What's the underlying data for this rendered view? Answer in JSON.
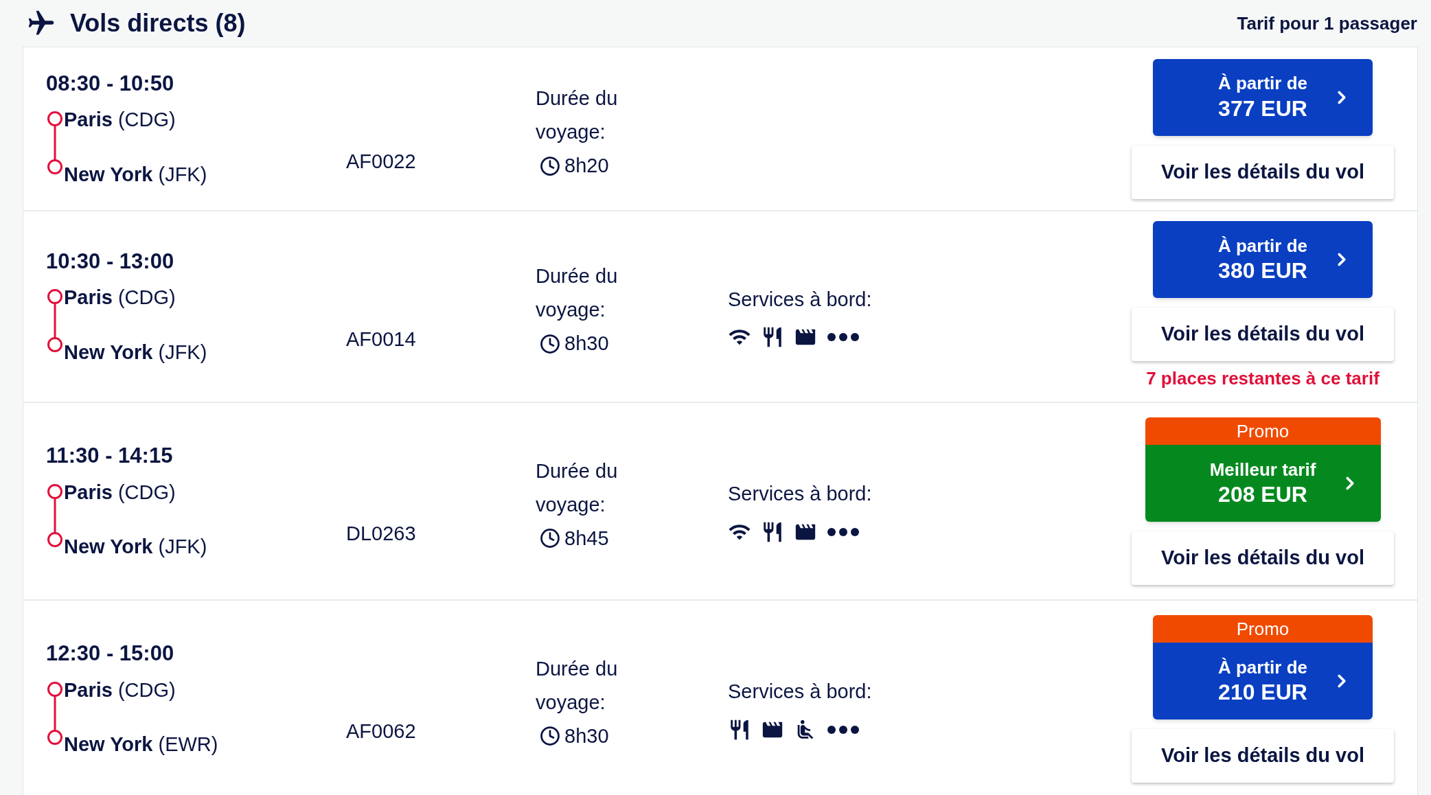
{
  "header": {
    "title": "Vols directs (8)",
    "fare_note": "Tarif pour 1 passager"
  },
  "flights": [
    {
      "times": "08:30 - 10:50",
      "origin": {
        "city": "Paris",
        "code": "(CDG)"
      },
      "destination": {
        "city": "New York",
        "code": "(JFK)"
      },
      "flight_number": "AF0022",
      "duration_label": "Durée du voyage:",
      "duration": "8h20",
      "price": {
        "kind": "standard",
        "caption": "À partir de",
        "amount": "377 EUR"
      },
      "details_button": "Voir les détails du vol"
    },
    {
      "times": "10:30 - 13:00",
      "origin": {
        "city": "Paris",
        "code": "(CDG)"
      },
      "destination": {
        "city": "New York",
        "code": "(JFK)"
      },
      "flight_number": "AF0014",
      "duration_label": "Durée du voyage:",
      "duration": "8h30",
      "services_label": "Services à bord:",
      "services": [
        {
          "kind": "wifi"
        },
        {
          "kind": "meal"
        },
        {
          "kind": "movie"
        },
        {
          "kind": "more"
        }
      ],
      "price": {
        "kind": "standard",
        "caption": "À partir de",
        "amount": "380 EUR"
      },
      "details_button": "Voir les détails du vol",
      "seats_note": "7 places restantes à ce tarif"
    },
    {
      "times": "11:30 - 14:15",
      "origin": {
        "city": "Paris",
        "code": "(CDG)"
      },
      "destination": {
        "city": "New York",
        "code": "(JFK)"
      },
      "flight_number": "DL0263",
      "duration_label": "Durée du voyage:",
      "duration": "8h45",
      "services_label": "Services à bord:",
      "services": [
        {
          "kind": "wifi"
        },
        {
          "kind": "meal"
        },
        {
          "kind": "movie"
        },
        {
          "kind": "more"
        }
      ],
      "price": {
        "kind": "best",
        "promo": "Promo",
        "caption": "Meilleur tarif",
        "amount": "208 EUR"
      },
      "details_button": "Voir les détails du vol"
    },
    {
      "times": "12:30 - 15:00",
      "origin": {
        "city": "Paris",
        "code": "(CDG)"
      },
      "destination": {
        "city": "New York",
        "code": "(EWR)"
      },
      "flight_number": "AF0062",
      "duration_label": "Durée du voyage:",
      "duration": "8h30",
      "services_label": "Services à bord:",
      "services": [
        {
          "kind": "meal"
        },
        {
          "kind": "movie"
        },
        {
          "kind": "seat"
        },
        {
          "kind": "more"
        }
      ],
      "price": {
        "kind": "standard",
        "promo": "Promo",
        "caption": "À partir de",
        "amount": "210 EUR"
      },
      "details_button": "Voir les détails du vol"
    }
  ]
}
